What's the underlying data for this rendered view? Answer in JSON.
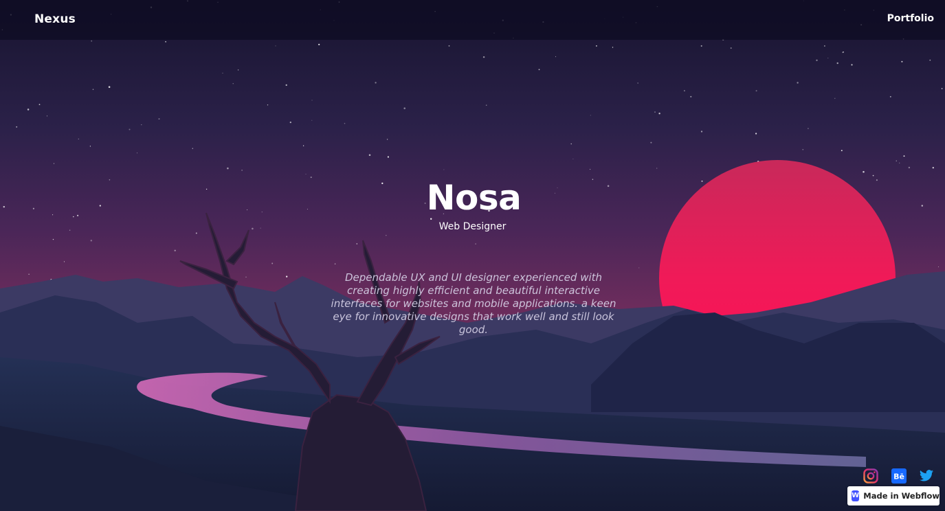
{
  "header": {
    "brand": "Nexus",
    "nav": [
      {
        "label": "Portfolio"
      }
    ]
  },
  "hero": {
    "title": "Nosa",
    "subtitle": "Web Designer",
    "description": "Dependable UX and UI designer experienced with creating highly efficient and beautiful interactive interfaces for websites and mobile applications. a keen eye for innovative designs that work well and still look good."
  },
  "social": [
    {
      "icon": "instagram-icon",
      "color": "#e1306c"
    },
    {
      "icon": "behance-icon",
      "label": "Bē",
      "color": "#1769ff"
    },
    {
      "icon": "twitter-icon",
      "color": "#1da1f2"
    }
  ],
  "badge": {
    "logo_letter": "W",
    "label": "Made in Webflow"
  },
  "colors": {
    "sky_top": "#1b1838",
    "sky_mid": "#3b2556",
    "horizon": "#6b2c5b",
    "sun": "#ff1a5a",
    "river": "#c45ba8",
    "mountains": "#2a2e52"
  }
}
